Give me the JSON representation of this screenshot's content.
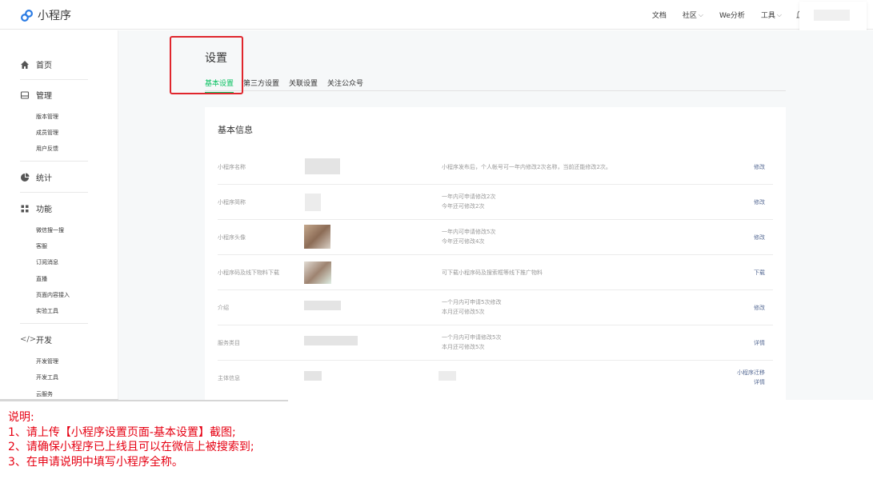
{
  "app": {
    "name": "小程序"
  },
  "topnav": {
    "items": [
      {
        "label": "文档",
        "dropdown": false
      },
      {
        "label": "社区",
        "dropdown": true
      },
      {
        "label": "We分析",
        "dropdown": false
      },
      {
        "label": "工具",
        "dropdown": true
      }
    ]
  },
  "sidebar": {
    "sections": [
      {
        "label": "首页",
        "icon": "home-icon"
      },
      {
        "label": "管理",
        "icon": "manage-icon"
      },
      {
        "label": "统计",
        "icon": "stats-icon"
      },
      {
        "label": "功能",
        "icon": "function-icon"
      },
      {
        "label": "开发",
        "icon": "code-icon"
      }
    ],
    "manage_items": [
      "版本管理",
      "成员管理",
      "用户反馈"
    ],
    "function_items": [
      "微信搜一搜",
      "客服",
      "订阅消息",
      "直播",
      "页面内容接入",
      "实验工具"
    ],
    "dev_items": [
      "开发管理",
      "开发工具",
      "云服务"
    ]
  },
  "page": {
    "title": "设置",
    "tabs": [
      "基本设置",
      "第三方设置",
      "关联设置",
      "关注公众号"
    ],
    "active_tab": 0
  },
  "card": {
    "title": "基本信息",
    "rows": [
      {
        "label": "小程序名称",
        "desc1": "小程序发布后，个人帐号可一年内修改2次名称，当前还能修改2次。",
        "desc2": "",
        "action1": "修改",
        "action2": ""
      },
      {
        "label": "小程序简称",
        "desc1": "一年内可申请修改2次",
        "desc2": "今年还可修改2次",
        "action1": "修改",
        "action2": ""
      },
      {
        "label": "小程序头像",
        "desc1": "一年内可申请修改5次",
        "desc2": "今年还可修改4次",
        "action1": "修改",
        "action2": ""
      },
      {
        "label": "小程序码及线下物料下载",
        "desc1": "可下载小程序码及搜索框等线下推广物料",
        "desc2": "",
        "action1": "下载",
        "action2": ""
      },
      {
        "label": "介绍",
        "desc1": "一个月内可申请5次修改",
        "desc2": "本月还可修改5次",
        "action1": "修改",
        "action2": ""
      },
      {
        "label": "服务类目",
        "desc1": "一个月内可申请修改5次",
        "desc2": "本月还可修改5次",
        "action1": "详情",
        "action2": ""
      },
      {
        "label": "主体信息",
        "desc1": "",
        "desc2": "",
        "action1": "小程序迁移",
        "action2": "详情"
      }
    ]
  },
  "note": {
    "title": "说明:",
    "lines": [
      "1、请上传【小程序设置页面-基本设置】截图;",
      "2、请确保小程序已上线且可以在微信上被搜索到;",
      "3、在申请说明中填写小程序全称。"
    ]
  },
  "colors": {
    "accent": "#07c160",
    "link": "#576b95",
    "highlight": "#e0262d",
    "note": "#e60012"
  }
}
